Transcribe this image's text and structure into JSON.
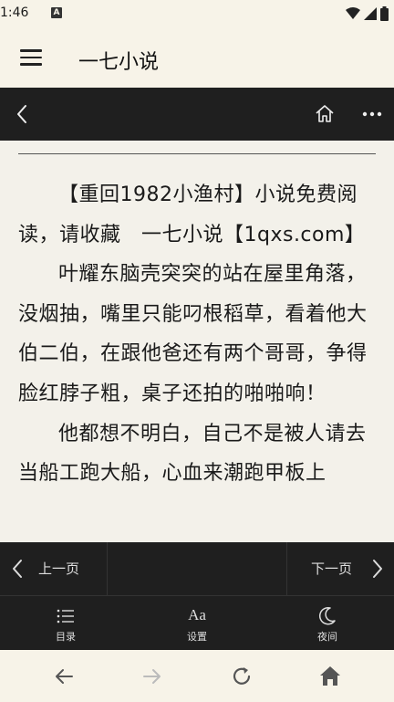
{
  "status_bar": {
    "time": "1:46",
    "notification_badge": "A"
  },
  "app_bar": {
    "title": "一七小说",
    "menu_icon": "hamburger-menu-icon"
  },
  "reader_bar": {
    "back_icon": "back-arrow-icon",
    "home_icon": "home-icon",
    "more_icon": "more-dots-icon"
  },
  "content": {
    "paragraphs": [
      "【重回1982小渔村】小说免费阅读，请收藏　一七小说【1qxs.com】",
      "叶耀东脑壳突突的站在屋里角落，没烟抽，嘴里只能叼根稻草，看着他大伯二伯，在跟他爸还有两个哥哥，争得脸红脖子粗，桌子还拍的啪啪响！",
      "他都想不明白，自己不是被人请去当船工跑大船，心血来潮跑甲板上"
    ]
  },
  "pager": {
    "prev_label": "上一页",
    "next_label": "下一页"
  },
  "toolbar": {
    "toc_label": "目录",
    "settings_label": "设置",
    "night_label": "夜间"
  },
  "browser_nav": {
    "icons": [
      "back-icon",
      "forward-icon",
      "reload-icon",
      "home-icon"
    ]
  },
  "colors": {
    "dark_bar": "#1f1f1f",
    "paper": "#f3f1ea",
    "app_bg": "#f7f3e8"
  }
}
